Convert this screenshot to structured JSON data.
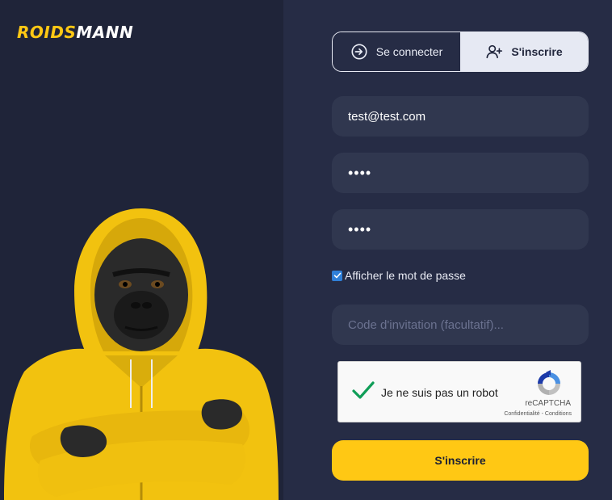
{
  "brand": {
    "part1": "ROIDS",
    "part2": "MANN"
  },
  "tabs": {
    "login_label": "Se connecter",
    "signup_label": "S'inscrire"
  },
  "form": {
    "email_value": "test@test.com",
    "password_value": "••••",
    "password_confirm_value": "••••",
    "show_password_label": "Afficher le mot de passe",
    "show_password_checked": true,
    "invite_placeholder": "Code d'invitation (facultatif)...",
    "submit_label": "S'inscrire"
  },
  "captcha": {
    "label": "Je ne suis pas un robot",
    "brand": "reCAPTCHA",
    "legal": "Confidentialité - Conditions",
    "checked": true
  },
  "colors": {
    "accent": "#ffc814",
    "background": "#262c45",
    "left_panel": "#1f2439",
    "field": "#30374f"
  }
}
